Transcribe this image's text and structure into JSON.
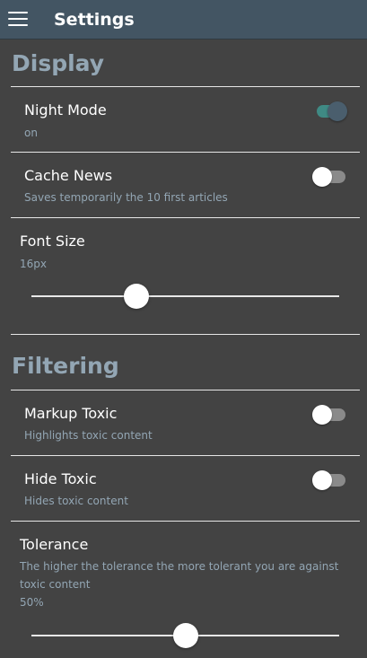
{
  "app": {
    "title": "Settings",
    "menu_icon": "hamburger-menu-icon"
  },
  "display": {
    "section_title": "Display",
    "night_mode": {
      "label": "Night Mode",
      "sub": "on",
      "enabled": true
    },
    "cache_news": {
      "label": "Cache News",
      "sub": "Saves temporarily the 10 first articles",
      "enabled": false
    },
    "font_size": {
      "label": "Font Size",
      "value_text": "16px",
      "position_fraction": 0.34
    }
  },
  "filtering": {
    "section_title": "Filtering",
    "markup_toxic": {
      "label": "Markup Toxic",
      "sub": "Highlights toxic content",
      "enabled": false
    },
    "hide_toxic": {
      "label": "Hide Toxic",
      "sub": "Hides toxic content",
      "enabled": false
    },
    "tolerance": {
      "label": "Tolerance",
      "description_line1": "The higher the tolerance the more tolerant you are against",
      "description_line2": "toxic content",
      "value_text": "50%",
      "value": 0.5
    }
  },
  "colors": {
    "topbar": "#435563",
    "background": "#434343",
    "section_title": "#93a6b4",
    "toggle_on_track": "#3f8a84"
  }
}
